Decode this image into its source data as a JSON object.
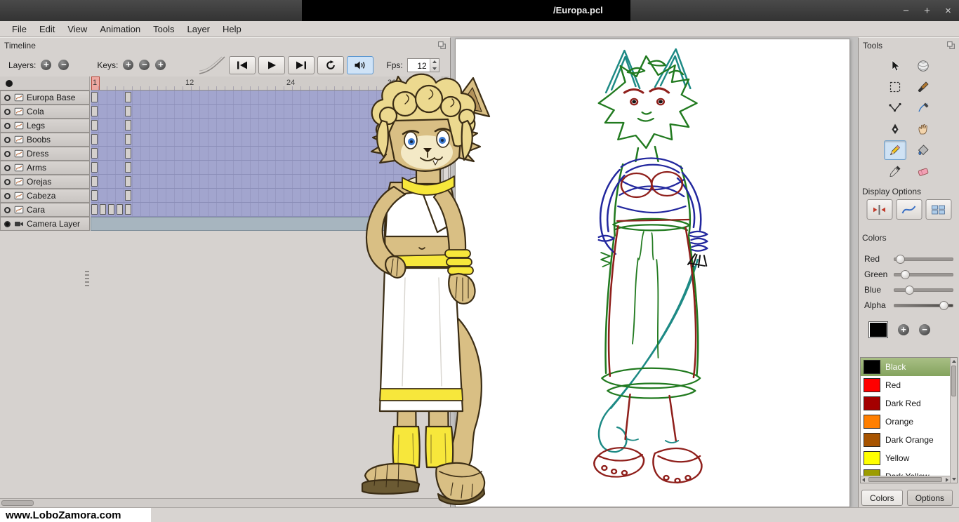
{
  "window": {
    "title": "/Europa.pcl",
    "controls": [
      {
        "name": "minimize",
        "glyph": "−"
      },
      {
        "name": "maximize",
        "glyph": "+"
      },
      {
        "name": "close",
        "glyph": "×"
      }
    ]
  },
  "menu": {
    "items": [
      "File",
      "Edit",
      "View",
      "Animation",
      "Tools",
      "Layer",
      "Help"
    ]
  },
  "timeline": {
    "title": "Timeline",
    "layers_label": "Layers:",
    "keys_label": "Keys:",
    "layer_buttons": [
      {
        "name": "add-layer",
        "glyph": "+"
      },
      {
        "name": "remove-layer",
        "glyph": "−"
      }
    ],
    "key_buttons": [
      {
        "name": "add-key",
        "glyph": "+"
      },
      {
        "name": "remove-key",
        "glyph": "−"
      },
      {
        "name": "duplicate-key",
        "glyph": "+"
      }
    ],
    "playback": [
      {
        "name": "skip-back",
        "icon": "skip-back"
      },
      {
        "name": "play",
        "icon": "play"
      },
      {
        "name": "skip-forward",
        "icon": "skip-forward"
      },
      {
        "name": "loop",
        "icon": "loop"
      },
      {
        "name": "sound",
        "icon": "sound",
        "active": true
      }
    ],
    "fps_label": "Fps:",
    "fps_value": "12",
    "ruler_marks": [
      1,
      12,
      24,
      36
    ],
    "current_frame": 1,
    "layers": [
      {
        "name": "Europa Base",
        "type": "bitmap",
        "keys": [
          1,
          5
        ]
      },
      {
        "name": "Cola",
        "type": "bitmap",
        "keys": [
          1,
          5
        ]
      },
      {
        "name": "Legs",
        "type": "bitmap",
        "keys": [
          1,
          5
        ]
      },
      {
        "name": "Boobs",
        "type": "bitmap",
        "keys": [
          1,
          5
        ]
      },
      {
        "name": "Dress",
        "type": "bitmap",
        "keys": [
          1,
          5
        ]
      },
      {
        "name": "Arms",
        "type": "bitmap",
        "keys": [
          1,
          5
        ]
      },
      {
        "name": "Orejas",
        "type": "bitmap",
        "keys": [
          1,
          5
        ]
      },
      {
        "name": "Cabeza",
        "type": "bitmap",
        "keys": [
          1,
          5
        ]
      },
      {
        "name": "Cara",
        "type": "bitmap",
        "keys": [
          1,
          2,
          3,
          4,
          5
        ]
      },
      {
        "name": "Camera Layer",
        "type": "camera",
        "keys": []
      }
    ]
  },
  "tools_panel": {
    "title": "Tools",
    "tools": [
      {
        "name": "move"
      },
      {
        "name": "smudge"
      },
      {
        "name": "select"
      },
      {
        "name": "brush"
      },
      {
        "name": "polyline"
      },
      {
        "name": "draw"
      },
      {
        "name": "pen"
      },
      {
        "name": "hand"
      },
      {
        "name": "pencil",
        "selected": true
      },
      {
        "name": "bucket"
      },
      {
        "name": "eyedropper"
      },
      {
        "name": "eraser"
      }
    ],
    "display_options_label": "Display Options",
    "display_buttons": [
      {
        "name": "mirror-horizontal"
      },
      {
        "name": "onion-skin"
      },
      {
        "name": "multilayer-onion"
      }
    ],
    "colors_label": "Colors",
    "sliders": [
      {
        "label": "Red",
        "pct": 10
      },
      {
        "label": "Green",
        "pct": 18
      },
      {
        "label": "Blue",
        "pct": 25
      },
      {
        "label": "Alpha",
        "pct": 84
      }
    ],
    "current_color": "#000000",
    "swatch_buttons": [
      {
        "name": "add-color",
        "glyph": "+"
      },
      {
        "name": "remove-color",
        "glyph": "−"
      }
    ],
    "palette": [
      {
        "name": "Black",
        "color": "#000000",
        "selected": true
      },
      {
        "name": "Red",
        "color": "#ff0000"
      },
      {
        "name": "Dark Red",
        "color": "#a40000"
      },
      {
        "name": "Orange",
        "color": "#ff7f00"
      },
      {
        "name": "Dark Orange",
        "color": "#a85400"
      },
      {
        "name": "Yellow",
        "color": "#ffff00"
      },
      {
        "name": "Dark Yellow",
        "color": "#9c9c00"
      }
    ],
    "tabs": [
      {
        "label": "Colors",
        "active": true
      },
      {
        "label": "Options",
        "active": false
      }
    ]
  },
  "watermark": "www.LoboZamora.com"
}
